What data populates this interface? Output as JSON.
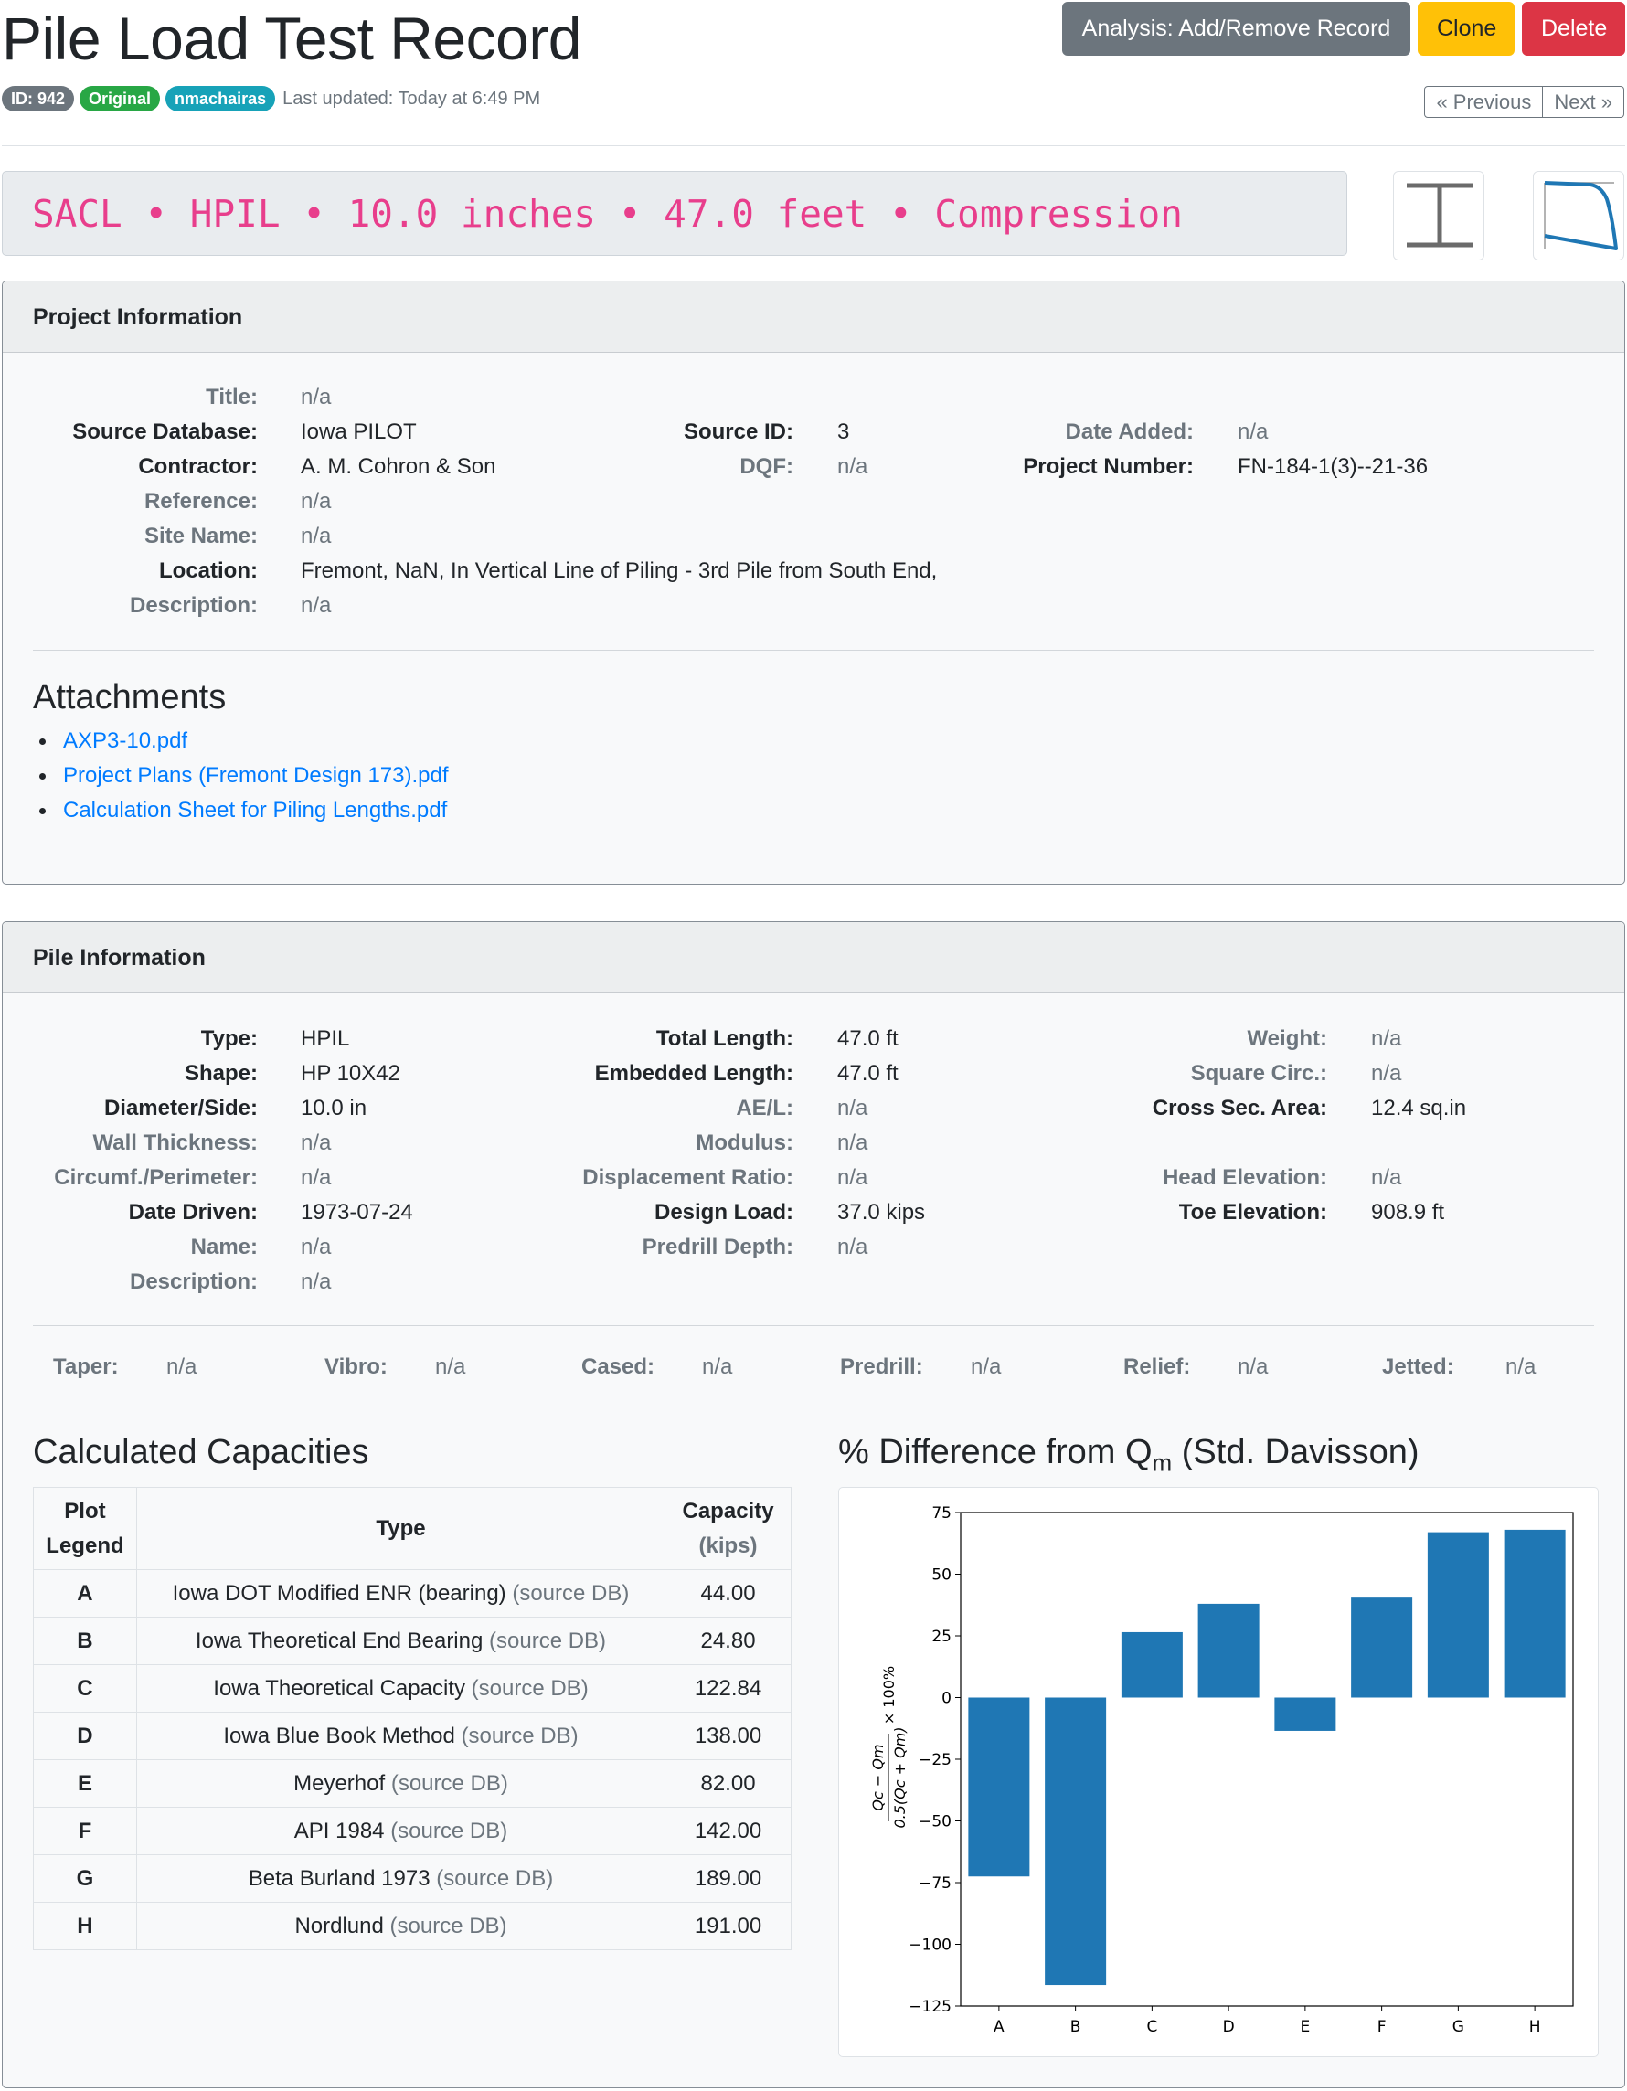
{
  "header": {
    "title": "Pile Load Test Record",
    "buttons": {
      "analysis": "Analysis: Add/Remove Record",
      "clone": "Clone",
      "delete": "Delete"
    },
    "badges": {
      "id": "ID: 942",
      "status": "Original",
      "user": "nmachairas"
    },
    "last_updated": "Last updated: Today at 6:49 PM",
    "pager": {
      "previous": "« Previous",
      "next": "Next »"
    }
  },
  "summary": "SACL • HPIL • 10.0 inches • 47.0 feet • Compression",
  "thumbnails": {
    "pile_icon": "h-pile-icon",
    "curve_icon": "load-curve-icon"
  },
  "project": {
    "header": "Project Information",
    "title": {
      "label": "Title:",
      "value": "n/a"
    },
    "source_database": {
      "label": "Source Database:",
      "value": "Iowa PILOT"
    },
    "contractor": {
      "label": "Contractor:",
      "value": "A. M. Cohron & Son"
    },
    "reference": {
      "label": "Reference:",
      "value": "n/a"
    },
    "site_name": {
      "label": "Site Name:",
      "value": "n/a"
    },
    "location": {
      "label": "Location:",
      "value": "Fremont, NaN, In Vertical Line of Piling - 3rd Pile from South End,"
    },
    "description": {
      "label": "Description:",
      "value": "n/a"
    },
    "source_id": {
      "label": "Source ID:",
      "value": "3"
    },
    "dqf": {
      "label": "DQF:",
      "value": "n/a"
    },
    "date_added": {
      "label": "Date Added:",
      "value": "n/a"
    },
    "project_number": {
      "label": "Project Number:",
      "value": "FN-184-1(3)--21-36"
    },
    "attachments_title": "Attachments",
    "attachments": [
      "AXP3-10.pdf",
      "Project Plans (Fremont Design 173).pdf",
      "Calculation Sheet for Piling Lengths.pdf"
    ]
  },
  "pile": {
    "header": "Pile Information",
    "type": {
      "label": "Type:",
      "value": "HPIL"
    },
    "shape": {
      "label": "Shape:",
      "value": "HP 10X42"
    },
    "diameter": {
      "label": "Diameter/Side:",
      "value": "10.0 in"
    },
    "wall_thickness": {
      "label": "Wall Thickness:",
      "value": "n/a"
    },
    "circumference": {
      "label": "Circumf./Perimeter:",
      "value": "n/a"
    },
    "date_driven": {
      "label": "Date Driven:",
      "value": "1973-07-24"
    },
    "name": {
      "label": "Name:",
      "value": "n/a"
    },
    "description": {
      "label": "Description:",
      "value": "n/a"
    },
    "total_length": {
      "label": "Total Length:",
      "value": "47.0 ft"
    },
    "embedded_length": {
      "label": "Embedded Length:",
      "value": "47.0 ft"
    },
    "ae_l": {
      "label": "AE/L:",
      "value": "n/a"
    },
    "modulus": {
      "label": "Modulus:",
      "value": "n/a"
    },
    "displacement_ratio": {
      "label": "Displacement Ratio:",
      "value": "n/a"
    },
    "design_load": {
      "label": "Design Load:",
      "value": "37.0 kips"
    },
    "predrill_depth": {
      "label": "Predrill Depth:",
      "value": "n/a"
    },
    "weight": {
      "label": "Weight:",
      "value": "n/a"
    },
    "square_circ": {
      "label": "Square Circ.:",
      "value": "n/a"
    },
    "cross_sec_area": {
      "label": "Cross Sec. Area:",
      "value": "12.4 sq.in"
    },
    "head_elevation": {
      "label": "Head Elevation:",
      "value": "n/a"
    },
    "toe_elevation": {
      "label": "Toe Elevation:",
      "value": "908.9 ft"
    },
    "flags": [
      {
        "label": "Taper:",
        "value": "n/a"
      },
      {
        "label": "Vibro:",
        "value": "n/a"
      },
      {
        "label": "Cased:",
        "value": "n/a"
      },
      {
        "label": "Predrill:",
        "value": "n/a"
      },
      {
        "label": "Relief:",
        "value": "n/a"
      },
      {
        "label": "Jetted:",
        "value": "n/a"
      }
    ]
  },
  "capacities": {
    "title": "Calculated Capacities",
    "columns": {
      "legend_1": "Plot",
      "legend_2": "Legend",
      "type": "Type",
      "capacity": "Capacity",
      "unit": "(kips)"
    },
    "source_tag": "(source DB)",
    "rows": [
      {
        "legend": "A",
        "type": "Iowa DOT Modified ENR (bearing)",
        "capacity": "44.00"
      },
      {
        "legend": "B",
        "type": "Iowa Theoretical End Bearing",
        "capacity": "24.80"
      },
      {
        "legend": "C",
        "type": "Iowa Theoretical Capacity",
        "capacity": "122.84"
      },
      {
        "legend": "D",
        "type": "Iowa Blue Book Method",
        "capacity": "138.00"
      },
      {
        "legend": "E",
        "type": "Meyerhof",
        "capacity": "82.00"
      },
      {
        "legend": "F",
        "type": "API 1984",
        "capacity": "142.00"
      },
      {
        "legend": "G",
        "type": "Beta Burland 1973",
        "capacity": "189.00"
      },
      {
        "legend": "H",
        "type": "Nordlund",
        "capacity": "191.00"
      }
    ]
  },
  "diff_chart": {
    "title_prefix": "% Difference from Q",
    "title_sub": "m",
    "title_suffix": " (Std. Davisson)"
  },
  "chart_data": {
    "type": "bar",
    "categories": [
      "A",
      "B",
      "C",
      "D",
      "E",
      "F",
      "G",
      "H"
    ],
    "values": [
      -72.5,
      -116.5,
      26.5,
      38,
      -13.5,
      40.5,
      67,
      68
    ],
    "ylabel": "(Qc − Qm) / 0.5(Qc + Qm) × 100%",
    "ylim": [
      -125,
      75
    ],
    "yticks": [
      75,
      50,
      25,
      0,
      -25,
      -50,
      -75,
      -100,
      -125
    ],
    "color": "#1f77b4",
    "grid": false
  },
  "colors": {
    "accent_code": "#e83e8c",
    "link": "#007bff",
    "btn_secondary": "#6c757d",
    "btn_warning": "#ffc107",
    "btn_danger": "#dc3545",
    "badge_success": "#28a745",
    "badge_info": "#17a2b8"
  }
}
